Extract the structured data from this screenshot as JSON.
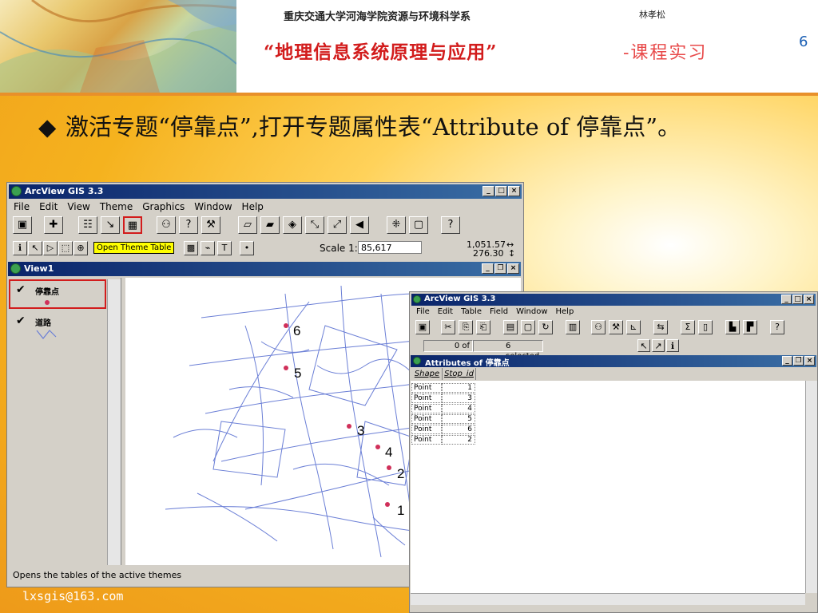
{
  "slide": {
    "school": "重庆交通大学河海学院资源与环境科学系",
    "author": "林孝松",
    "course_title": "“地理信息系统原理与应用”",
    "course_suffix": "-课程实习",
    "page_number": "6",
    "bullet_text": "激活专题“停靠点”,打开专题属性表“Attribute of 停靠点”。",
    "email": "lxsgis@163.com"
  },
  "main_window": {
    "title": "ArcView GIS 3.3",
    "menu": [
      "File",
      "Edit",
      "View",
      "Theme",
      "Graphics",
      "Window",
      "Help"
    ],
    "tooltip": "Open Theme Table",
    "scale_label": "Scale 1:",
    "scale_value": "85,617",
    "coord_x": "1,051.57",
    "coord_y": "276.30",
    "view_title": "View1",
    "toc": [
      {
        "label": "停靠点",
        "checked": true
      },
      {
        "label": "道路",
        "checked": true
      }
    ],
    "status": "Opens the tables of the active themes"
  },
  "attr_window": {
    "title": "ArcView GIS 3.3",
    "menu": [
      "File",
      "Edit",
      "Table",
      "Field",
      "Window",
      "Help"
    ],
    "selected_count": "0 of",
    "selected_total": "6 selected",
    "table_title": "Attributes of 停靠点",
    "columns": [
      "Shape",
      "Stop_id"
    ],
    "rows": [
      [
        "Point",
        "1"
      ],
      [
        "Point",
        "3"
      ],
      [
        "Point",
        "4"
      ],
      [
        "Point",
        "5"
      ],
      [
        "Point",
        "6"
      ],
      [
        "Point",
        "2"
      ]
    ]
  },
  "map_points": [
    "6",
    "5",
    "3",
    "4",
    "2",
    "1"
  ],
  "colors": {
    "accent_red": "#d21c1c",
    "title_blue": "#0a246a",
    "stop_point": "#d0305a",
    "road": "#6b7fd6"
  }
}
